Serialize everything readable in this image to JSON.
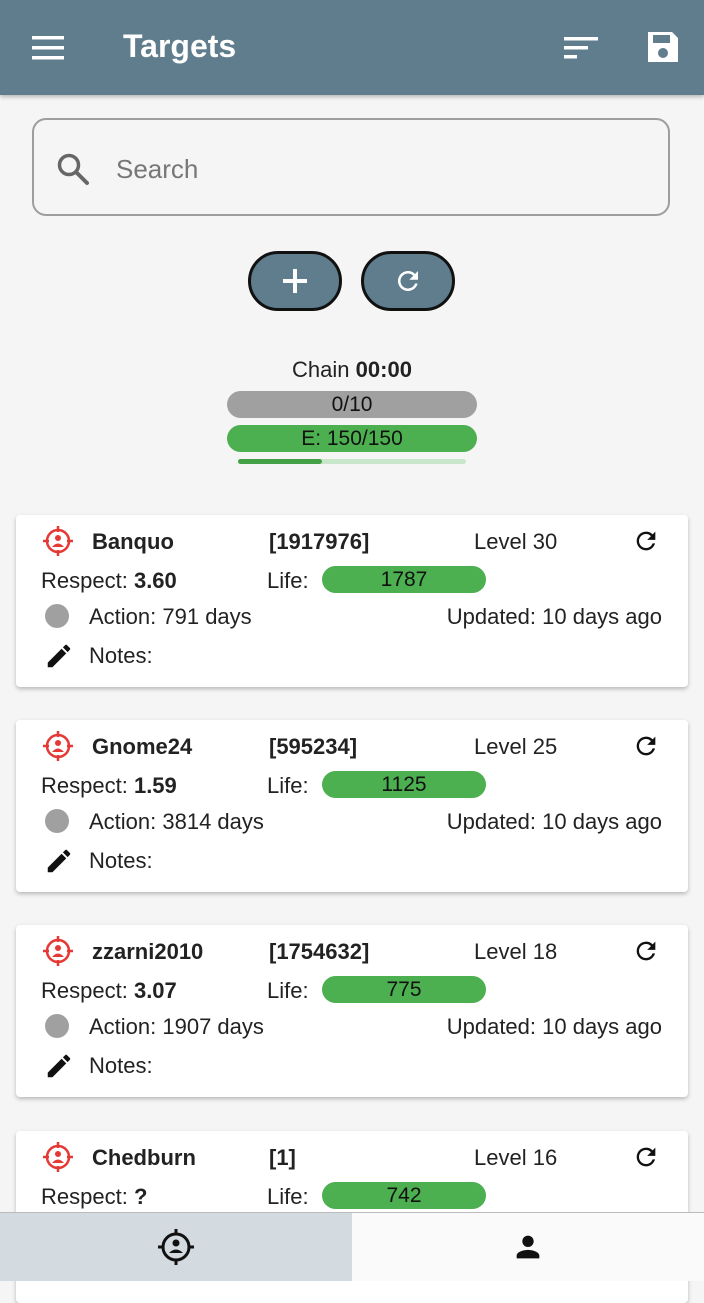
{
  "appbar": {
    "title": "Targets",
    "icons": {
      "menu": "menu-icon",
      "sort": "sort-icon",
      "save": "save-icon"
    },
    "color": "#5f7d8c"
  },
  "search": {
    "placeholder": "Search",
    "value": ""
  },
  "actions": {
    "add": "add-icon",
    "refresh": "refresh-icon"
  },
  "chain": {
    "label": "Chain",
    "time": "00:00",
    "progress_text": "0/10",
    "energy_text": "E: 150/150",
    "energy_fraction": 1.0,
    "sub_progress_fraction": 0.37
  },
  "targets": [
    {
      "name": "Banquo",
      "id": "[1917976]",
      "level": "Level 30",
      "respect_label": "Respect:",
      "respect": "3.60",
      "life_label": "Life:",
      "life": "1787",
      "action": "Action: 791 days",
      "updated": "Updated: 10 days ago",
      "notes": "Notes:"
    },
    {
      "name": "Gnome24",
      "id": "[595234]",
      "level": "Level 25",
      "respect_label": "Respect:",
      "respect": "1.59",
      "life_label": "Life:",
      "life": "1125",
      "action": "Action: 3814 days",
      "updated": "Updated: 10 days ago",
      "notes": "Notes:"
    },
    {
      "name": "zzarni2010",
      "id": "[1754632]",
      "level": "Level 18",
      "respect_label": "Respect:",
      "respect": "3.07",
      "life_label": "Life:",
      "life": "775",
      "action": "Action: 1907 days",
      "updated": "Updated: 10 days ago",
      "notes": "Notes:"
    },
    {
      "name": "Chedburn",
      "id": "[1]",
      "level": "Level 16",
      "respect_label": "Respect:",
      "respect": "?",
      "life_label": "Life:",
      "life": "742",
      "action": "",
      "updated": "",
      "notes": ""
    }
  ],
  "bottom_nav": [
    {
      "icon": "crosshair-person-icon",
      "active": true
    },
    {
      "icon": "person-icon",
      "active": false
    }
  ],
  "colors": {
    "green": "#4caf50",
    "grey": "#a0a0a0",
    "red": "#e53935"
  }
}
